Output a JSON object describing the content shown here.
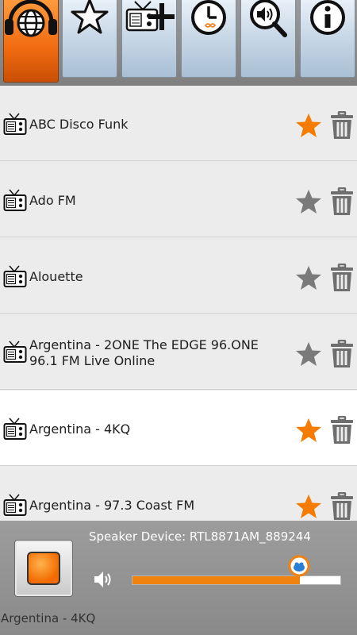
{
  "tabs": [
    {
      "id": "radio",
      "icon": "radio-globe-headphones-icon",
      "active": true
    },
    {
      "id": "favorites",
      "icon": "star-icon",
      "active": false
    },
    {
      "id": "add-station",
      "icon": "radio-add-icon",
      "active": false
    },
    {
      "id": "timer",
      "icon": "clock-icon",
      "active": false
    },
    {
      "id": "search",
      "icon": "search-speaker-icon",
      "active": false
    },
    {
      "id": "info",
      "icon": "info-icon",
      "active": false
    }
  ],
  "stations": [
    {
      "name": "ABC Disco Funk",
      "favorite": true,
      "selected": false
    },
    {
      "name": "Ado FM",
      "favorite": false,
      "selected": false
    },
    {
      "name": "Alouette",
      "favorite": false,
      "selected": false
    },
    {
      "name": "Argentina - 2ONE The EDGE 96.ONE 96.1 FM Live Online",
      "favorite": false,
      "selected": false
    },
    {
      "name": "Argentina - 4KQ",
      "favorite": true,
      "selected": true
    },
    {
      "name": "Argentina - 97.3 Coast FM",
      "favorite": true,
      "selected": false
    }
  ],
  "player": {
    "speaker_label": "Speaker Device:  RTL8871AM_889244",
    "volume": 0.8,
    "now_playing": "Argentina - 4KQ"
  },
  "colors": {
    "accent": "#f0820f",
    "star_on": "#f57c00",
    "star_off": "#7a7a7a",
    "trash": "#6e6e6e"
  }
}
